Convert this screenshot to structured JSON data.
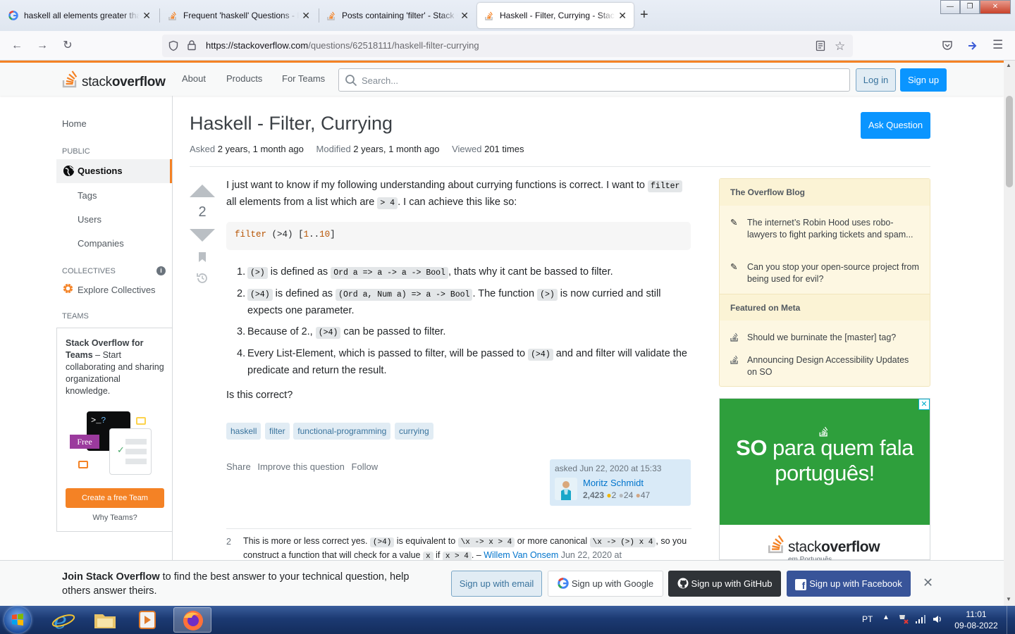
{
  "browser": {
    "tabs": [
      {
        "title": "haskell all elements greater than"
      },
      {
        "title": "Frequent 'haskell' Questions - P"
      },
      {
        "title": "Posts containing 'filter' - Stack O"
      },
      {
        "title": "Haskell - Filter, Currying - Stack"
      }
    ],
    "url_host": "https://stackoverflow.com",
    "url_path": "/questions/62518111/haskell-filter-currying"
  },
  "so_header": {
    "logo_text_light": "stack",
    "logo_text_bold": "overflow",
    "nav": [
      "About",
      "Products",
      "For Teams"
    ],
    "search_placeholder": "Search...",
    "login": "Log in",
    "signup": "Sign up"
  },
  "sidebar": {
    "home": "Home",
    "public_heading": "PUBLIC",
    "questions": "Questions",
    "tags": "Tags",
    "users": "Users",
    "companies": "Companies",
    "collectives_heading": "COLLECTIVES",
    "explore_collectives": "Explore Collectives",
    "teams_heading": "TEAMS",
    "teams_bold": "Stack Overflow for Teams",
    "teams_text": " – Start collaborating and sharing organizational knowledge.",
    "free_badge": "Free",
    "create_team": "Create a free Team",
    "why_teams": "Why Teams?"
  },
  "question": {
    "title": "Haskell - Filter, Currying",
    "ask_button": "Ask Question",
    "asked_label": "Asked",
    "asked_value": "2 years, 1 month ago",
    "modified_label": "Modified",
    "modified_value": "2 years, 1 month ago",
    "viewed_label": "Viewed",
    "viewed_value": "201 times",
    "score": "2",
    "intro_1": "I just want to know if my following understanding about currying functions is correct. I want to ",
    "intro_code_1": "filter",
    "intro_2": " all elements from a list which are ",
    "intro_code_2": "> 4",
    "intro_3": ". I can achieve this like so:",
    "code_fn": "filter",
    "code_op": "(>4)",
    "code_list_open": "[",
    "code_list_from": "1",
    "code_list_dots": "..",
    "code_list_to": "10",
    "code_list_close": "]",
    "list": [
      {
        "n": "1.",
        "c1": "(>)",
        "t1": " is defined as ",
        "c2": "Ord a => a -> a -> Bool",
        "t2": ", thats why it cant be bassed to filter."
      },
      {
        "n": "2.",
        "c1": "(>4)",
        "t1": " is defined as ",
        "c2": "(Ord a, Num a) => a -> Bool",
        "t2": ". The function ",
        "c3": "(>)",
        "t3": " is now curried and still expects one parameter."
      },
      {
        "n": "3.",
        "t0": "Because of 2., ",
        "c1": "(>4)",
        "t1": " can be passed to filter."
      },
      {
        "n": "4.",
        "t0": "Every List-Element, which is passed to filter, will be passed to ",
        "c1": "(>4)",
        "t1": " and and filter will validate the predicate and return the result."
      }
    ],
    "closing": "Is this correct?",
    "tags": [
      "haskell",
      "filter",
      "functional-programming",
      "currying"
    ],
    "actions": [
      "Share",
      "Improve this question",
      "Follow"
    ],
    "asked_when": "asked Jun 22, 2020 at 15:33",
    "author": "Moritz Schmidt",
    "author_rep": "2,423",
    "badges_gold": "2",
    "badges_silver": "24",
    "badges_bronze": "47"
  },
  "comment": {
    "score": "2",
    "t1": "This is more or less correct yes. ",
    "c1": "(>4)",
    "t2": " is equivalent to ",
    "c2": "\\x -> x > 4",
    "t3": " or more canonical ",
    "c3": "\\x -> (>) x 4",
    "t4": ", so you construct a function that will check for a value ",
    "c4": "x",
    "t5": " if ",
    "c5": "x > 4",
    "t6": ". – ",
    "user": "Willem Van Onsem",
    "time": "Jun 22, 2020 at"
  },
  "blog": {
    "heading": "The Overflow Blog",
    "items": [
      "The internet’s Robin Hood uses robo-lawyers to fight parking tickets and spam...",
      "Can you stop your open-source project from being used for evil?"
    ],
    "meta_heading": "Featured on Meta",
    "meta_items": [
      "Should we burninate the [master] tag?",
      "Announcing Design Accessibility Updates on SO"
    ]
  },
  "ad": {
    "slogan_bold": "SO",
    "slogan_rest": " para quem fala português!",
    "logo_light": "stack",
    "logo_bold": "overflow",
    "logo_sub": "em Português"
  },
  "banner": {
    "bold": "Join Stack Overflow",
    "text": " to find the best answer to your technical question, help others answer theirs.",
    "email": "Sign up with email",
    "google": "Sign up with Google",
    "github": "Sign up with GitHub",
    "facebook": "Sign up with Facebook"
  },
  "taskbar": {
    "lang": "PT",
    "time": "11:01",
    "date": "09-08-2022"
  },
  "colors": {
    "so_orange": "#f48225",
    "so_blue": "#0a95ff",
    "tag_bg": "#e1ecf4",
    "blog_bg": "#fdf7e2",
    "ad_green": "#2e9f3c"
  }
}
